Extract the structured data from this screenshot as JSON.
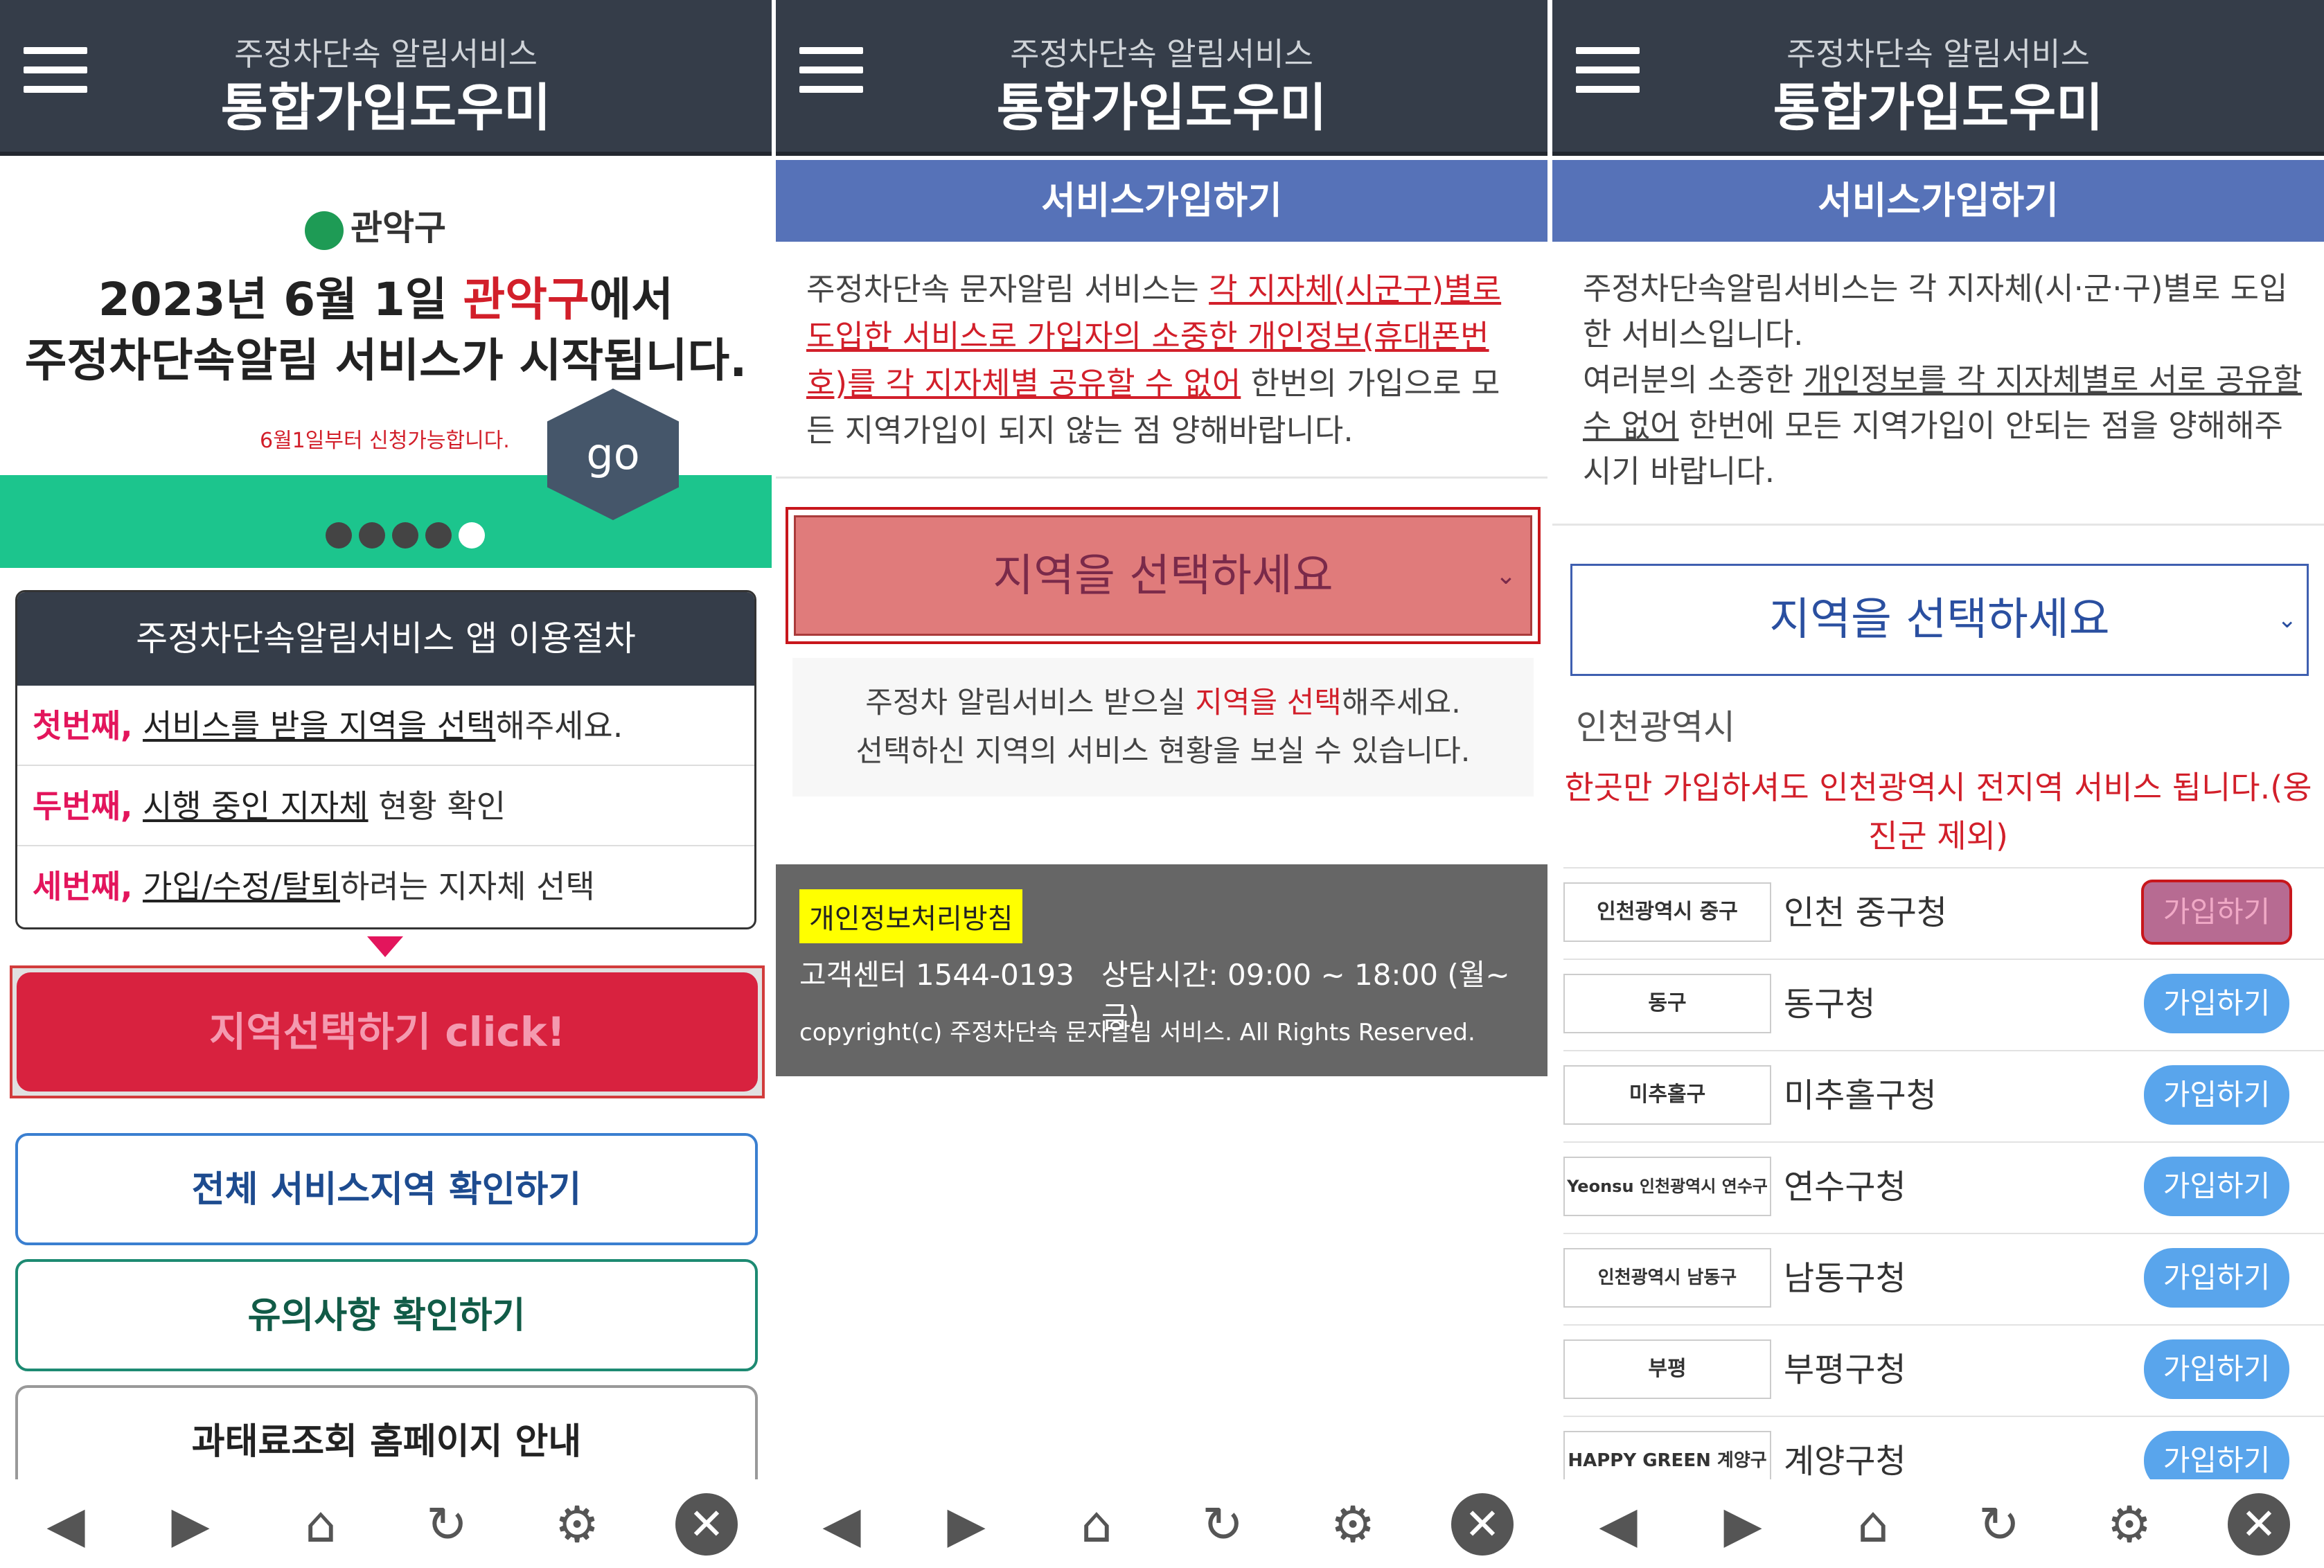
{
  "header": {
    "subtitle": "주정차단속 알림서비스",
    "title": "통합가입도우미"
  },
  "nav": {
    "back": "◀",
    "forward": "▶",
    "home": "⌂",
    "refresh": "↻",
    "settings": "⚙",
    "close": "✕"
  },
  "panel1": {
    "logo_text": "관악구",
    "headline_line1_a": "2023년 6월 1일 ",
    "headline_line1_b": "관악구",
    "headline_line1_c": "에서",
    "headline_line2": "주정차단속알림 서비스가 시작됩니다.",
    "note": "6월1일부터 신청가능합니다.",
    "go_label": "go",
    "carousel": {
      "count": 5,
      "active": 5
    },
    "procedure": {
      "title": "주정차단속알림서비스 앱 이용절차",
      "steps": [
        {
          "prefix": "첫번째,",
          "link": "서비스를 받을 지역을 선택",
          "suffix": "해주세요."
        },
        {
          "prefix": "두번째,",
          "link": "시행 중인 지자체",
          "suffix": " 현황 확인"
        },
        {
          "prefix": "세번째,",
          "link": "가입/수정/탈퇴",
          "suffix": "하려는 지자체 선택"
        }
      ]
    },
    "select_region_button": "지역선택하기 click!",
    "all_regions_button": "전체 서비스지역 확인하기",
    "notice_button": "유의사항 확인하기",
    "fine_lookup_button": "과태료조회 홈페이지 안내"
  },
  "panel2": {
    "bar_title": "서비스가입하기",
    "intro_a": "주정차단속 문자알림 서비스는 ",
    "intro_b": "각 지자체(시군구)별로 도입한 서비스로 가입자의 소중한 개인정보(휴대폰번호)를 각 지자체별 공유할 수 없어",
    "intro_c": " 한번의 가입으로 모든 지역가입이 되지 않는 점 양해바랍니다.",
    "select_placeholder": "지역을 선택하세요",
    "hint_a": "주정차 알림서비스 받으실 ",
    "hint_b": "지역을 선택",
    "hint_c": "해주세요.",
    "hint_line2": "선택하신 지역의 서비스 현황을 보실 수 있습니다.",
    "privacy_label": "개인정보처리방침",
    "customer_center": "고객센터 1544-0193",
    "hours": "상담시간: 09:00 ~ 18:00 (월~금)",
    "copyright": "copyright(c) 주정차단속 문자알림 서비스. All Rights Reserved."
  },
  "panel3": {
    "bar_title": "서비스가입하기",
    "intro_a": "주정차단속알림서비스는 각 지자체(시·군·구)별로 도입한 서비스입니다.",
    "intro_b": "여러분의 소중한 ",
    "intro_c": "개인정보를 각 지자체별로 서로 공유할 수 없어",
    "intro_d": " 한번에 모든 지역가입이 안되는 점을 양해해주시기 바랍니다.",
    "select_placeholder": "지역을 선택하세요",
    "region": "인천광역시",
    "region_note": "한곳만 가입하셔도 인천광역시 전지역 서비스 됩니다.(옹진군 제외)",
    "join_label": "가입하기",
    "orgs": [
      {
        "name": "인천 중구청",
        "logo": "인천광역시 중구"
      },
      {
        "name": "동구청",
        "logo": "동구"
      },
      {
        "name": "미추홀구청",
        "logo": "미추홀구"
      },
      {
        "name": "연수구청",
        "logo": "Yeonsu 인천광역시 연수구"
      },
      {
        "name": "남동구청",
        "logo": "인천광역시 남동구"
      },
      {
        "name": "부평구청",
        "logo": "부평"
      },
      {
        "name": "계양구청",
        "logo": "HAPPY GREEN 계양구"
      }
    ]
  },
  "colors": {
    "header": "#353d49",
    "bar": "#5672b8",
    "red": "#d21f2a",
    "join": "#59a5ec"
  }
}
